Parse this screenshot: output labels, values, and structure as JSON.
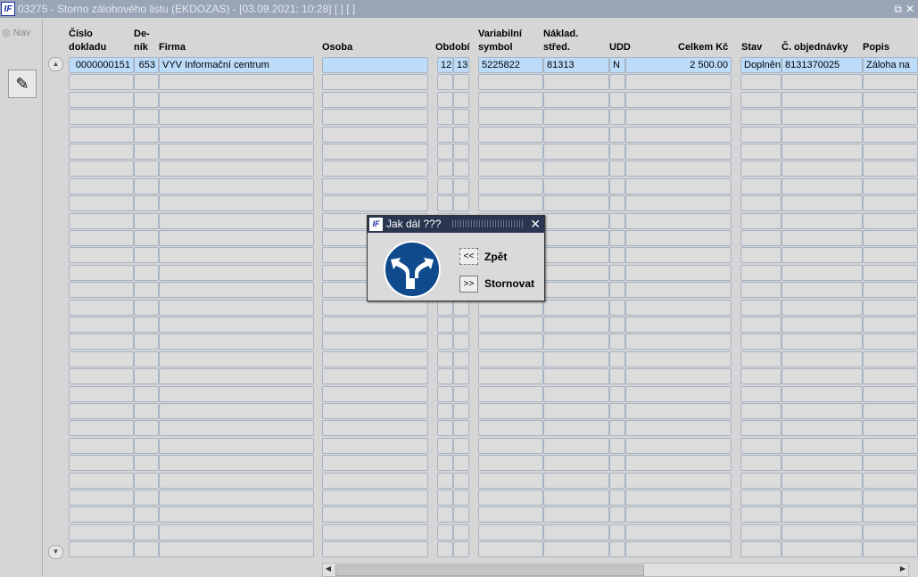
{
  "window": {
    "logo": "IF",
    "title": "03275 - Storno zálohového listu (EKDOZAS) - [03.09.2021; 10:28]  [ ]  [ ]",
    "restore_icon": "restore-icon",
    "close_icon": "close-icon"
  },
  "sidebar": {
    "nav_label": "Nav",
    "tool_icon": "eraser-icon"
  },
  "table": {
    "headers": [
      {
        "l1": "Číslo",
        "l2": "dokladu"
      },
      {
        "l1": "De-",
        "l2": "ník"
      },
      {
        "l1": "",
        "l2": "Firma"
      },
      {
        "l1": "",
        "l2": "Osoba"
      },
      {
        "l1": "",
        "l2": "Období"
      },
      {
        "l1": "Variabilní",
        "l2": "symbol"
      },
      {
        "l1": "Náklad.",
        "l2": "střed."
      },
      {
        "l1": "",
        "l2": "UDD"
      },
      {
        "l1": "",
        "l2": "Celkem Kč"
      },
      {
        "l1": "",
        "l2": "Stav"
      },
      {
        "l1": "",
        "l2": "Č. objednávky"
      },
      {
        "l1": "",
        "l2": "Popis"
      }
    ],
    "rows": [
      [
        "0000000151",
        "653",
        "VYV Informační centrum",
        "",
        "12",
        "13",
        "5225822",
        "81313",
        "N",
        "2 500.00",
        "Doplněn",
        "8131370025",
        "Záloha na"
      ]
    ],
    "empty_rows": 28
  },
  "dialog": {
    "logo": "IF",
    "title": "Jak dál ???",
    "close": "✕",
    "back_button": "<<",
    "back_label": "Zpět",
    "cancel_button": ">>",
    "cancel_label": "Stornovat",
    "sign_icon": "fork-arrow-sign-icon"
  }
}
